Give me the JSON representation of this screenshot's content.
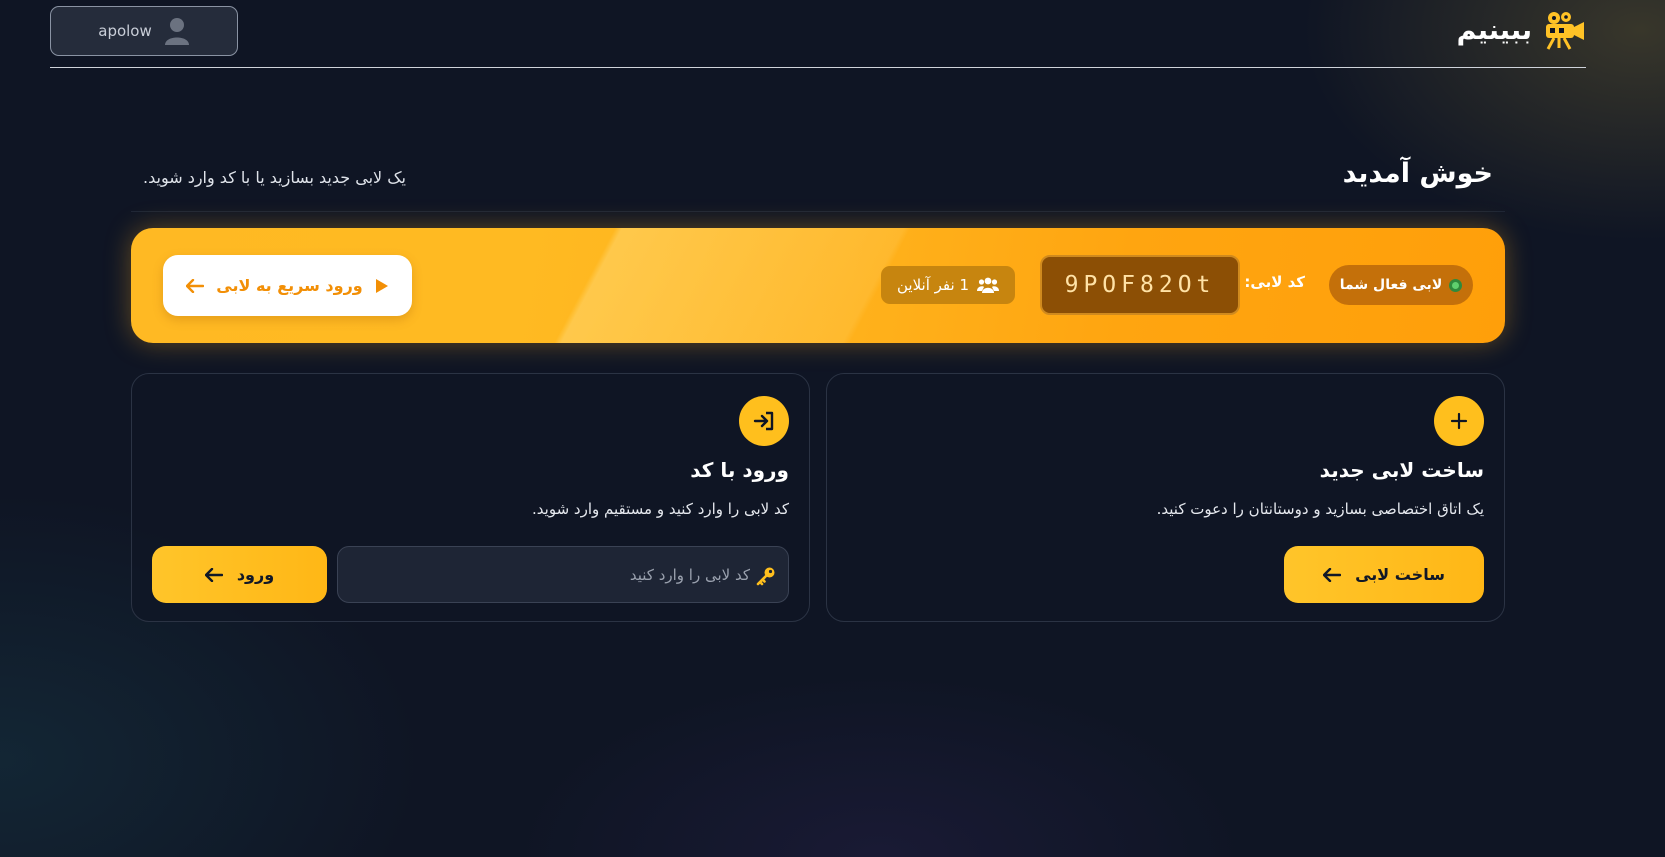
{
  "header": {
    "brand_name": "ببینیم",
    "brand_logo_icon": "projector-camera-icon",
    "user_name": "apolow",
    "user_avatar_icon": "user-avatar-icon"
  },
  "welcome": {
    "title": "خوش آمدید",
    "subtitle": "یک لابی جدید بسازید یا با کد وارد شوید."
  },
  "active_lobby": {
    "status_label": "لابی فعال شما",
    "code_label": "کد لابی:",
    "code": "9POF82Ot",
    "online_label": "1 نفر آنلاین",
    "quick_join_label": "ورود سریع به لابی"
  },
  "create_card": {
    "icon": "plus-icon",
    "title": "ساخت لابی جدید",
    "description": "یک اتاق اختصاصی بسازید و دوستانتان را دعوت کنید.",
    "button_label": "ساخت لابی"
  },
  "join_card": {
    "icon": "sign-in-icon",
    "title": "ورود با کد",
    "description": "کد لابی را وارد کنید و مستقیم وارد شوید.",
    "input_placeholder": "کد لابی را وارد کنید",
    "input_value": "",
    "button_label": "ورود"
  },
  "colors": {
    "background": "#0f1524",
    "accent_gold": "#ffbf1d",
    "banner_orange": "#ffa510",
    "status_green": "#5fd06e"
  }
}
